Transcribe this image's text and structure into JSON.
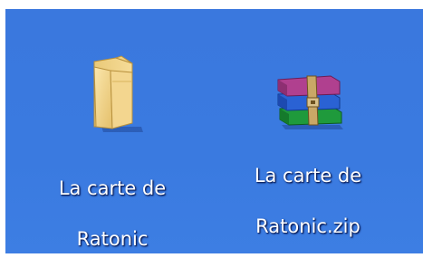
{
  "desktop": {
    "icons": [
      {
        "icon": "folder-icon",
        "label_line1": "La carte de",
        "label_line2": "Ratonic"
      },
      {
        "icon": "winrar-archive-icon",
        "label_line1": "La carte de",
        "label_line2": "Ratonic.zip"
      }
    ]
  },
  "colors": {
    "desktop_background": "#3a78de",
    "label_text": "#ffffff"
  }
}
